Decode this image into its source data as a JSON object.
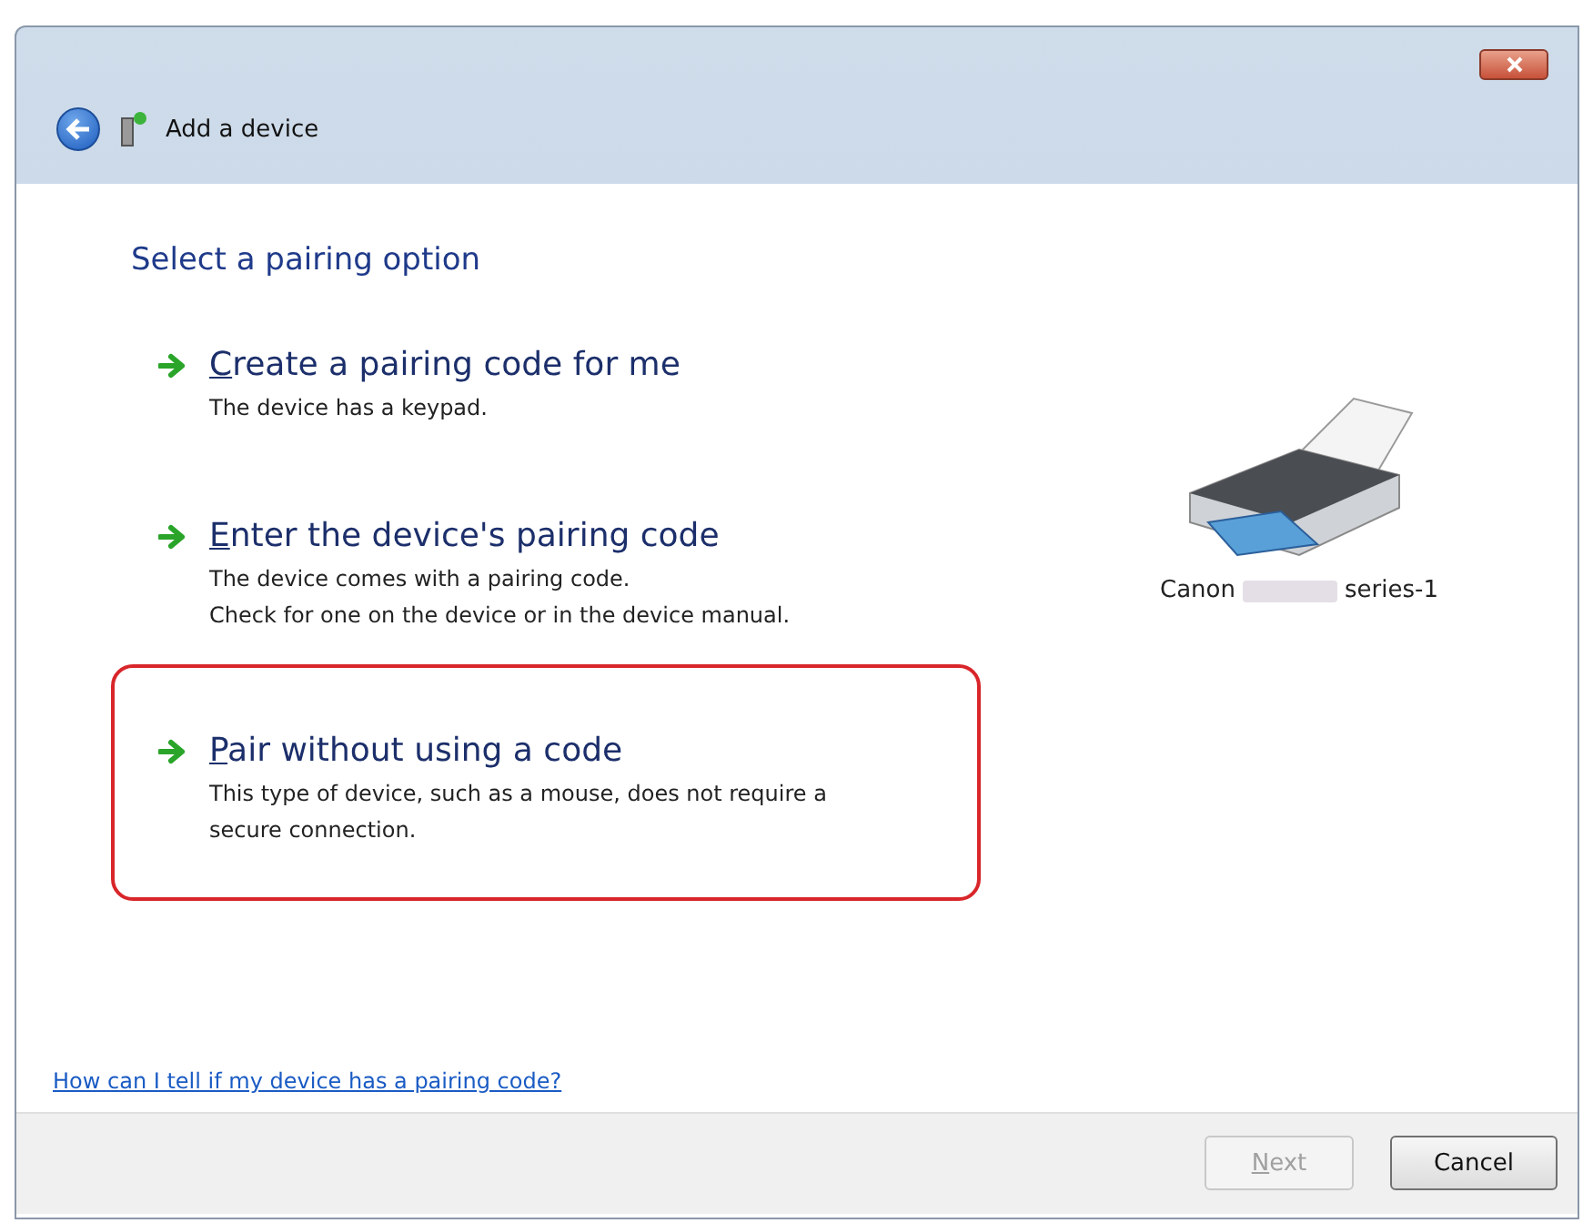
{
  "window": {
    "title": "Add a device"
  },
  "heading": "Select a pairing option",
  "options": [
    {
      "title": "Create a pairing code for me",
      "description": [
        "The device has a keypad."
      ],
      "highlighted": false
    },
    {
      "title": "Enter the device's pairing code",
      "description": [
        "The device comes with a pairing code.",
        "Check for one on the device or in the device manual."
      ],
      "highlighted": false
    },
    {
      "title": "Pair without using a code",
      "description": [
        "This type of device, such as a mouse, does not require a",
        "secure connection."
      ],
      "highlighted": true
    }
  ],
  "device": {
    "name_start": "Canon",
    "name_end": "series-1"
  },
  "help_link": "How can I tell if my device has a pairing code?",
  "buttons": [
    {
      "label": "Next",
      "disabled": true
    },
    {
      "label": "Cancel",
      "disabled": false
    }
  ]
}
